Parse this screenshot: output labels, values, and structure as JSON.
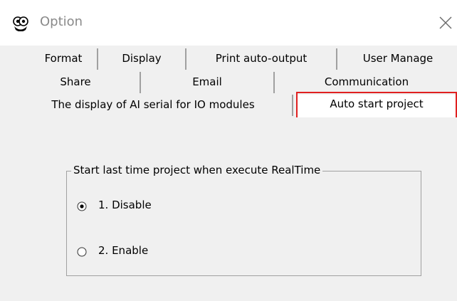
{
  "window": {
    "title": "Option",
    "icon": "app-logo-icon",
    "close_icon": "close-icon"
  },
  "tabs": {
    "row1": [
      "Format",
      "Display",
      "Print auto-output",
      "User Manage"
    ],
    "row2": [
      "Share",
      "Email",
      "Communication"
    ],
    "row3": [
      "The display of AI serial for IO modules",
      "Auto start project"
    ],
    "active": "Auto start project"
  },
  "group": {
    "legend": "Start last time project when execute RealTime",
    "options": [
      {
        "label": "1. Disable",
        "selected": true
      },
      {
        "label": "2. Enable",
        "selected": false
      }
    ]
  },
  "colors": {
    "highlight": "#e02020",
    "dialog_bg": "#f0f0f0"
  }
}
